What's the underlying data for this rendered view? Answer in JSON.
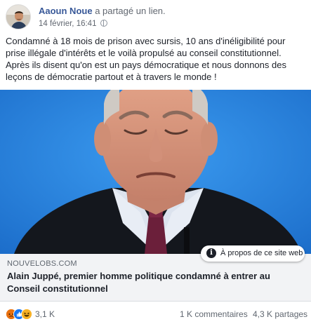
{
  "post": {
    "author": "Aaoun Noue",
    "action": "a partagé un lien.",
    "date": "14 février, 16:41",
    "globe_icon": "globe-icon",
    "text": "Condamné à 18 mois de prison avec sursis, 10 ans d'inéligibilité pour prise illégale d'intérêts et le voilà propulsé au conseil constitutionnel. Après ils disent qu'on est un pays démocratique et nous donnons des leçons de démocratie partout et à travers le monde !"
  },
  "link": {
    "domain": "NOUVELOBS.COM",
    "headline": "Alain Juppé, premier homme politique condamné à entrer au Conseil constitutionnel",
    "about_label": "À propos de ce site web",
    "about_icon": "info-icon"
  },
  "footer": {
    "reaction_icons": [
      "angry-icon",
      "like-icon",
      "haha-icon"
    ],
    "reaction_count": "3,1 K",
    "comments": "1 K commentaires",
    "shares": "4,3 K partages"
  },
  "colors": {
    "author": "#385898",
    "photo_background": "#2a8ae0",
    "link_box": "#f2f3f5",
    "like": "#1877f2",
    "angry": "#e9710f",
    "haha": "#f7b125"
  }
}
